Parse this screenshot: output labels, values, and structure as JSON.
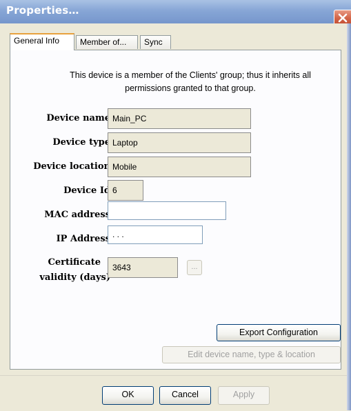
{
  "window": {
    "title": "Properties…",
    "close_icon": "close-icon"
  },
  "tabs": [
    {
      "label": "General Info",
      "active": true
    },
    {
      "label": "Member of...",
      "active": false
    },
    {
      "label": "Sync",
      "active": false
    }
  ],
  "general": {
    "info_text_line1": "This device is a member of the Clients' group; thus it inherits all",
    "info_text_line2": "permissions granted to that group.",
    "fields": {
      "device_name": {
        "label": "Device name",
        "value": "Main_PC",
        "editable": false
      },
      "device_type": {
        "label": "Device type",
        "value": "Laptop",
        "editable": false
      },
      "device_location": {
        "label": "Device location",
        "value": "Mobile",
        "editable": false
      },
      "device_id": {
        "label": "Device Id",
        "value": "6",
        "editable": false
      },
      "mac_address": {
        "label": "MAC address",
        "value": "",
        "editable": true
      },
      "ip_address": {
        "label": "IP Address",
        "value": "  .   .   .",
        "editable": true
      },
      "certificate_validity": {
        "label_line1": "Certificate",
        "label_line2": "validity (days)",
        "value": "3643",
        "editable": false
      }
    },
    "browse_button_label": "...",
    "export_button_label": "Export Configuration",
    "edit_button_label": "Edit device name, type & location"
  },
  "footer": {
    "ok_label": "OK",
    "cancel_label": "Cancel",
    "apply_label": "Apply"
  },
  "colors": {
    "title_bar": "#87a6d6",
    "close_button": "#d3664a",
    "dialog_face": "#ece9d8",
    "active_tab_highlight": "#e8a13c"
  }
}
